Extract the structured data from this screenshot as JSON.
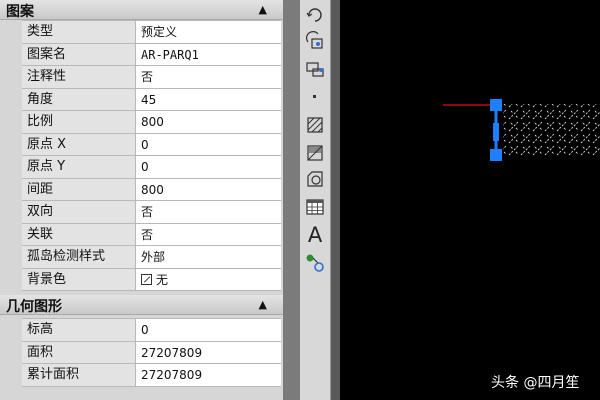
{
  "properties_panel": {
    "pattern_section": {
      "title": "图案",
      "rows": [
        {
          "label": "类型",
          "value": "预定义"
        },
        {
          "label": "图案名",
          "value": "AR-PARQ1"
        },
        {
          "label": "注释性",
          "value": "否"
        },
        {
          "label": "角度",
          "value": "45"
        },
        {
          "label": "比例",
          "value": "800"
        },
        {
          "label": "原点 X",
          "value": "0"
        },
        {
          "label": "原点 Y",
          "value": "0"
        },
        {
          "label": "间距",
          "value": "800"
        },
        {
          "label": "双向",
          "value": "否"
        },
        {
          "label": "关联",
          "value": "否"
        },
        {
          "label": "孤岛检测样式",
          "value": "外部"
        },
        {
          "label": "背景色",
          "value": "无"
        }
      ]
    },
    "geometry_section": {
      "title": "几何图形",
      "rows": [
        {
          "label": "标高",
          "value": "0"
        },
        {
          "label": "面积",
          "value": "27207809"
        },
        {
          "label": "累计面积",
          "value": "27207809"
        }
      ]
    }
  },
  "toolbar": {
    "text_tool_glyph": "A",
    "icons": [
      "rotate-icon",
      "copy-rotate-icon",
      "move-icon",
      "point-icon",
      "hatch-icon",
      "gradient-icon",
      "region-icon",
      "table-icon",
      "text-icon",
      "insert-block-icon"
    ]
  },
  "canvas": {
    "background_color": "#000000",
    "grip_color": "#1e7fff",
    "boundary_color": "#e01010"
  },
  "watermark": "头条 @四月笙"
}
